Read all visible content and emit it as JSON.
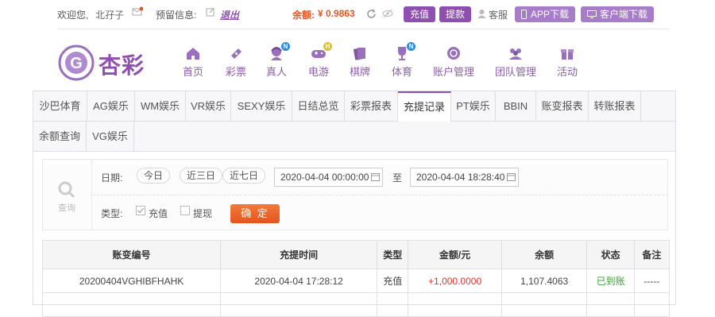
{
  "topbar": {
    "welcome": "欢迎您,",
    "username": "北孖子",
    "warning_label": "预留信息:",
    "logout": "退出",
    "balance_label": "余额:",
    "balance_value": "¥ 0.9863",
    "deposit": "充值",
    "withdraw": "提款",
    "service": "客服",
    "app_download": "APP下载",
    "client_download": "客户端下载",
    "colors": {
      "orange": "#e8561f",
      "purple": "#8e4fb0",
      "light_purple": "#a77cc9"
    }
  },
  "logo": {
    "text": "杏彩"
  },
  "nav": [
    {
      "label": "首页",
      "icon": "home-icon"
    },
    {
      "label": "彩票",
      "icon": "ticket-icon"
    },
    {
      "label": "真人",
      "icon": "live-dealer-icon",
      "badge": "N"
    },
    {
      "label": "电游",
      "icon": "gamepad-icon",
      "badge": "H"
    },
    {
      "label": "棋牌",
      "icon": "cards-icon"
    },
    {
      "label": "体育",
      "icon": "trophy-icon",
      "badge": "N"
    },
    {
      "label": "账户管理",
      "icon": "account-icon"
    },
    {
      "label": "团队管理",
      "icon": "team-icon"
    },
    {
      "label": "活动",
      "icon": "gift-icon"
    }
  ],
  "tabs_row1": [
    "沙巴体育",
    "AG娱乐",
    "WM娱乐",
    "VR娱乐",
    "SEXY娱乐",
    "日结总览",
    "彩票报表",
    "充提记录",
    "PT娱乐",
    "BBIN",
    "账变报表",
    "转账报表"
  ],
  "tabs_row2": [
    "余额查询",
    "VG娱乐"
  ],
  "active_tab": "充提记录",
  "filter": {
    "query_label": "查询",
    "date_label": "日期:",
    "quick_dates": [
      "今日",
      "近三日",
      "近七日"
    ],
    "start": "2020-04-04 00:00:00",
    "to": "至",
    "end": "2020-04-04 18:28:40",
    "type_label": "类型:",
    "types": [
      {
        "label": "充值",
        "checked": true
      },
      {
        "label": "提现",
        "checked": false
      }
    ],
    "confirm": "确 定"
  },
  "table": {
    "headers": [
      "账变编号",
      "充提时间",
      "类型",
      "金额/元",
      "余额",
      "状态",
      "备注"
    ],
    "rows": [
      [
        "20200404VGHIBFHAHK",
        "2020-04-04 17:28:12",
        "充值",
        "+1,000.0000",
        "1,107.4063",
        "已到账",
        "-----"
      ]
    ]
  }
}
